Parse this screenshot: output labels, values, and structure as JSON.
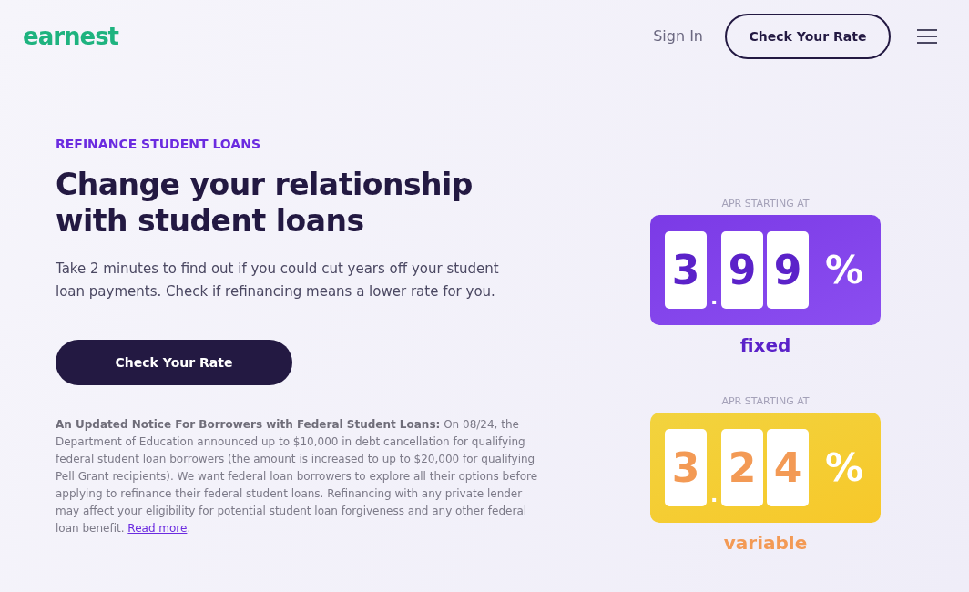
{
  "header": {
    "logo": "earnest",
    "sign_in": "Sign In",
    "cta": "Check Your Rate"
  },
  "hero": {
    "eyebrow": "REFINANCE STUDENT LOANS",
    "heading": "Change your relationship with student loans",
    "text": "Take 2 minutes to find out if you could cut years off your student loan payments. Check if refinancing means a lower rate for you.",
    "button": "Check Your Rate",
    "notice": {
      "text": "**An Updated Notice For Borrowers with Federal Student Loans:** On 08/24, the Department of Education announced up to $10,000 in debt cancellation for qualifying federal student loan borrowers (the amount is increased to up to $20,000 for qualifying Pell Grant recipients). We want federal loan borrowers to explore all their options before applying to refinance their federal student loans. Refinancing with any private lender may affect your eligibility for potential student loan forgiveness and any other federal loan benefit.",
      "link": "Read more",
      "after": "."
    }
  },
  "rates": [
    {
      "kind": "fixed",
      "label": "APR STARTING AT",
      "digits": [
        "3",
        "9",
        "9"
      ],
      "point": ".",
      "percent": "%",
      "type": "fixed"
    },
    {
      "kind": "variable",
      "label": "APR STARTING AT",
      "digits": [
        "3",
        "2",
        "4"
      ],
      "point": ".",
      "percent": "%",
      "type": "variable"
    }
  ]
}
